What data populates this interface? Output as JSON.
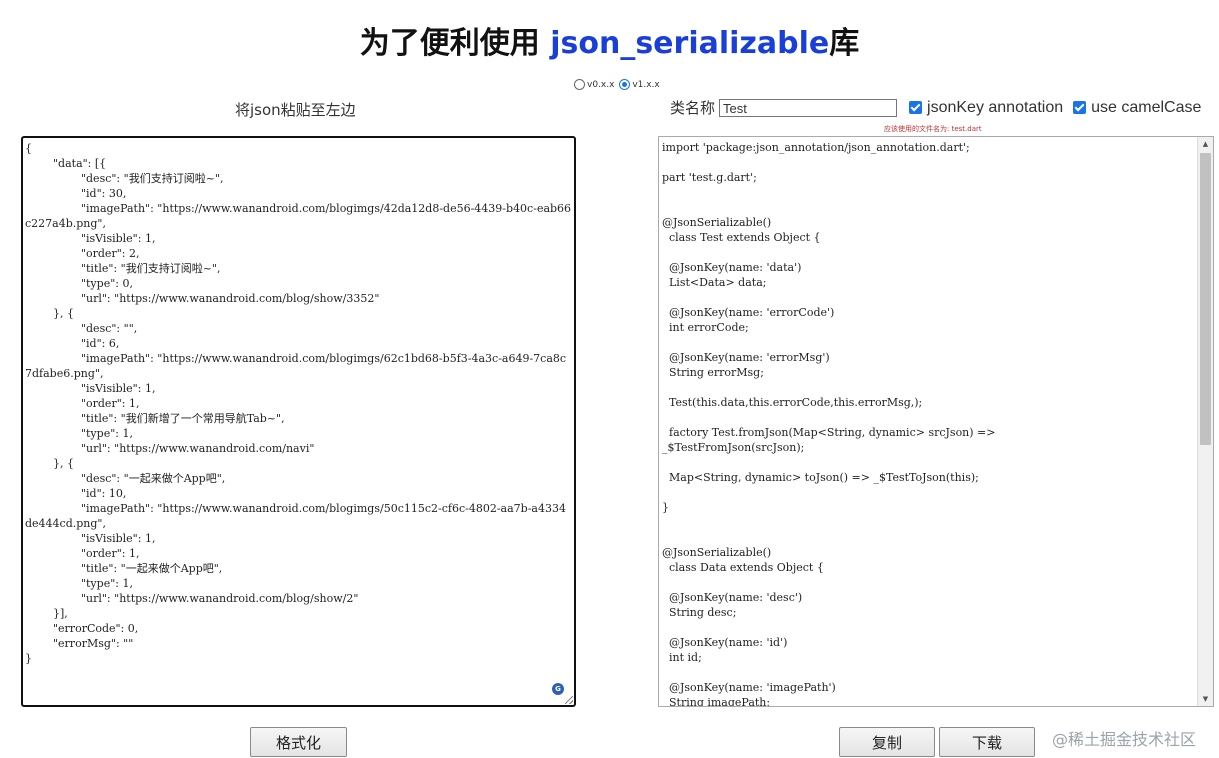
{
  "header": {
    "title_prefix": "为了便利使用 ",
    "title_highlight": "json_serializable",
    "title_suffix": "库"
  },
  "version_options": [
    {
      "label": "v0.x.x",
      "selected": false
    },
    {
      "label": "v1.x.x",
      "selected": true
    }
  ],
  "left_panel": {
    "label": "将json粘贴至左边",
    "content": "{\n        \"data\": [{\n                \"desc\": \"我们支持订阅啦~\",\n                \"id\": 30,\n                \"imagePath\": \"https://www.wanandroid.com/blogimgs/42da12d8-de56-4439-b40c-eab66c227a4b.png\",\n                \"isVisible\": 1,\n                \"order\": 2,\n                \"title\": \"我们支持订阅啦~\",\n                \"type\": 0,\n                \"url\": \"https://www.wanandroid.com/blog/show/3352\"\n        }, {\n                \"desc\": \"\",\n                \"id\": 6,\n                \"imagePath\": \"https://www.wanandroid.com/blogimgs/62c1bd68-b5f3-4a3c-a649-7ca8c7dfabe6.png\",\n                \"isVisible\": 1,\n                \"order\": 1,\n                \"title\": \"我们新增了一个常用导航Tab~\",\n                \"type\": 1,\n                \"url\": \"https://www.wanandroid.com/navi\"\n        }, {\n                \"desc\": \"一起来做个App吧\",\n                \"id\": 10,\n                \"imagePath\": \"https://www.wanandroid.com/blogimgs/50c115c2-cf6c-4802-aa7b-a4334de444cd.png\",\n                \"isVisible\": 1,\n                \"order\": 1,\n                \"title\": \"一起来做个App吧\",\n                \"type\": 1,\n                \"url\": \"https://www.wanandroid.com/blog/show/2\"\n        }],\n        \"errorCode\": 0,\n        \"errorMsg\": \"\"\n}",
    "format_button": "格式化"
  },
  "right_panel": {
    "class_name_label": "类名称",
    "class_name_value": "Test",
    "jsonkey_label": "jsonKey annotation",
    "jsonkey_checked": true,
    "camelcase_label": "use camelCase",
    "camelcase_checked": true,
    "file_hint": "应该使用的文件名为: test.dart",
    "content": "import 'package:json_annotation/json_annotation.dart';\n\npart 'test.g.dart';\n\n\n@JsonSerializable()\n  class Test extends Object {\n\n  @JsonKey(name: 'data')\n  List<Data> data;\n\n  @JsonKey(name: 'errorCode')\n  int errorCode;\n\n  @JsonKey(name: 'errorMsg')\n  String errorMsg;\n\n  Test(this.data,this.errorCode,this.errorMsg,);\n\n  factory Test.fromJson(Map<String, dynamic> srcJson) =>\n_$TestFromJson(srcJson);\n\n  Map<String, dynamic> toJson() => _$TestToJson(this);\n\n}\n\n\n@JsonSerializable()\n  class Data extends Object {\n\n  @JsonKey(name: 'desc')\n  String desc;\n\n  @JsonKey(name: 'id')\n  int id;\n\n  @JsonKey(name: 'imagePath')\n  String imagePath;",
    "copy_button": "复制",
    "download_button": "下载"
  },
  "watermark": "@稀土掘金技术社区",
  "colors": {
    "title_highlight": "#1a3fd9",
    "checkbox": "#1a73e8",
    "hint": "#c03030"
  }
}
